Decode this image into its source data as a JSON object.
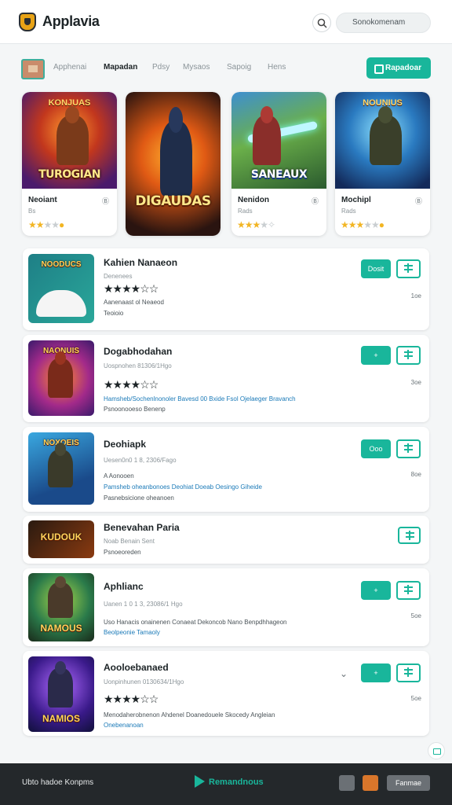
{
  "header": {
    "title": "Applavia",
    "search_placeholder": "Sonokomenam"
  },
  "nav": {
    "tabs": [
      "Apphenai",
      "Mapadan",
      "Pdsy",
      "Mysaos",
      "Sapoig",
      "Hens"
    ],
    "active_tab": "Mapadan",
    "cta_label": "Rapadoar"
  },
  "featured": [
    {
      "art_top": "KONJUAS",
      "art_title": "TUROGIAN",
      "name": "Neoiant",
      "sub": "Bs",
      "badge": "Ⓑ",
      "rating": 3
    },
    {
      "art_top": "",
      "art_title": "DIGAUDAS",
      "name": "",
      "sub": "",
      "badge": "",
      "rating": 0
    },
    {
      "art_top": "",
      "art_title": "SANEAUX",
      "name": "Nenidon",
      "sub": "Rads",
      "badge": "Ⓑ",
      "rating": 3
    },
    {
      "art_top": "NOUNIUS",
      "art_title": "",
      "name": "Mochipl",
      "sub": "Rads",
      "badge": "Ⓑ",
      "rating": 3
    }
  ],
  "apps": [
    {
      "thumb_title": "NOODUCS",
      "title": "Kahien Nanaeon",
      "meta": "Denenees",
      "rating": 4,
      "desc": "Aanenaast ol Neaeod",
      "desc2": "Teoioio",
      "link": "",
      "link2": "",
      "primary": "Dosit",
      "count": "1oe"
    },
    {
      "thumb_title": "NAONUIS",
      "title": "Dogabhodahan",
      "meta": "Uospnohen 81306/1Hgo",
      "rating": 4,
      "desc": "",
      "desc2": "",
      "link": "Hamsheb/Sochenlnonoler Bavesd 00 Bxide Fsol Ojelaeger Bravanch",
      "link2": "Psnoonooeso Benenp",
      "primary": "+",
      "count": "3oe"
    },
    {
      "thumb_title": "NOXOEIS",
      "title": "Deohiapk",
      "meta": "Uesen0n0 1 8, 2306/Fago",
      "rating": 0,
      "desc": "A Aonooen",
      "desc2": "Pasnebsicione oheanoen",
      "link": "Pamsheb oheanbonoes Deohiat Doeab Oesingo Giheide",
      "link2": "",
      "primary": "Ooo",
      "count": "8oe"
    },
    {
      "thumb_title": "KUDOUK",
      "title": "Benevahan Paria",
      "meta": "Noab Benain Sent",
      "rating": 0,
      "desc": "Psnoeoreden",
      "desc2": "",
      "link": "",
      "link2": "",
      "primary": "",
      "count": ""
    },
    {
      "thumb_title": "NAMOUS",
      "title": "Aphlianc",
      "meta": "Uanen 1 0 1 3, 23086/1 Hgo",
      "rating": 0,
      "desc": "Uso Hanacis onainenen Conaeat Dekoncob Nano Benpdhhageon",
      "desc2": "",
      "link": "Beolpeonie Tamaoly",
      "link2": "",
      "primary": "+ ",
      "count": "5oe"
    },
    {
      "thumb_title": "NAMIOS",
      "title": "Aooloebanaed",
      "meta": "Uonpinhunen 0130634/1Hgo",
      "rating": 4,
      "desc": "Menodaherobnenon Ahdenel Doanedouele Skocedy Angleian",
      "desc2": "",
      "link": "Onebenanoan",
      "link2": "",
      "primary": "+",
      "count": "5oe"
    }
  ],
  "footer": {
    "left_text": "Ubto hadoe Konpms",
    "center_text": "Remandnous",
    "right_button": "Fanmae"
  }
}
